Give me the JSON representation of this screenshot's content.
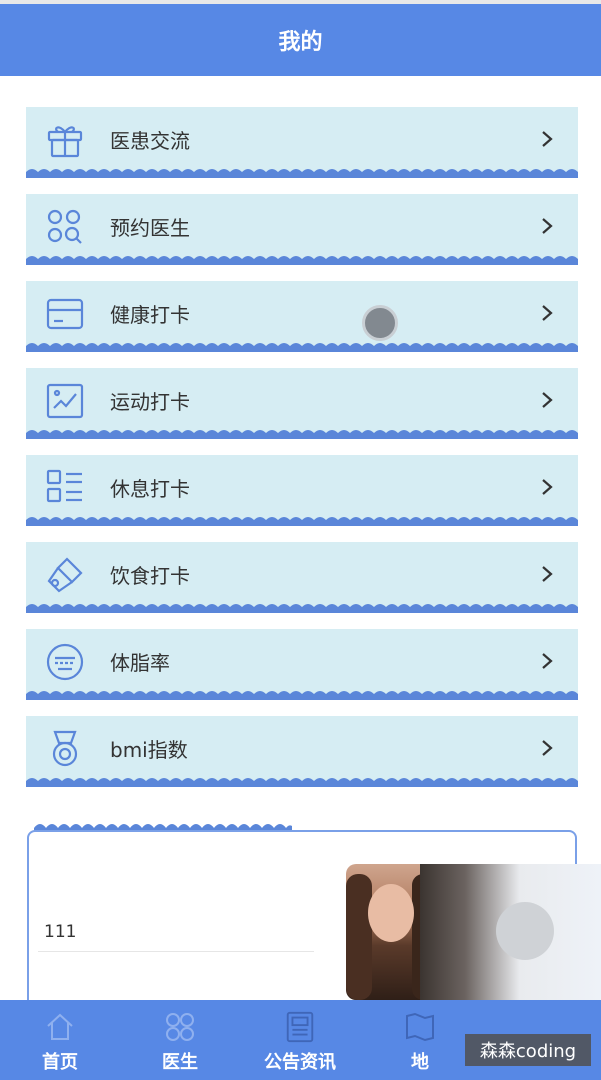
{
  "header": {
    "title": "我的"
  },
  "menu": {
    "items": [
      {
        "label": "医患交流",
        "icon": "gift-icon"
      },
      {
        "label": "预约医生",
        "icon": "apps-search-icon"
      },
      {
        "label": "健康打卡",
        "icon": "card-icon"
      },
      {
        "label": "运动打卡",
        "icon": "chart-icon"
      },
      {
        "label": "休息打卡",
        "icon": "list-icon"
      },
      {
        "label": "饮食打卡",
        "icon": "brush-icon"
      },
      {
        "label": "体脂率",
        "icon": "keyboard-icon"
      },
      {
        "label": "bmi指数",
        "icon": "medal-icon"
      }
    ]
  },
  "card": {
    "value": "111"
  },
  "tabbar": {
    "items": [
      {
        "label": "首页",
        "icon": "home-icon"
      },
      {
        "label": "医生",
        "icon": "apps-icon"
      },
      {
        "label": "公告资讯",
        "icon": "news-icon"
      },
      {
        "label": "地",
        "icon": "map-icon"
      }
    ]
  },
  "watermark": {
    "text": "森森coding"
  },
  "colors": {
    "primary": "#5788e5",
    "item_bg": "#d6edf3",
    "icon": "#5a86d9"
  }
}
